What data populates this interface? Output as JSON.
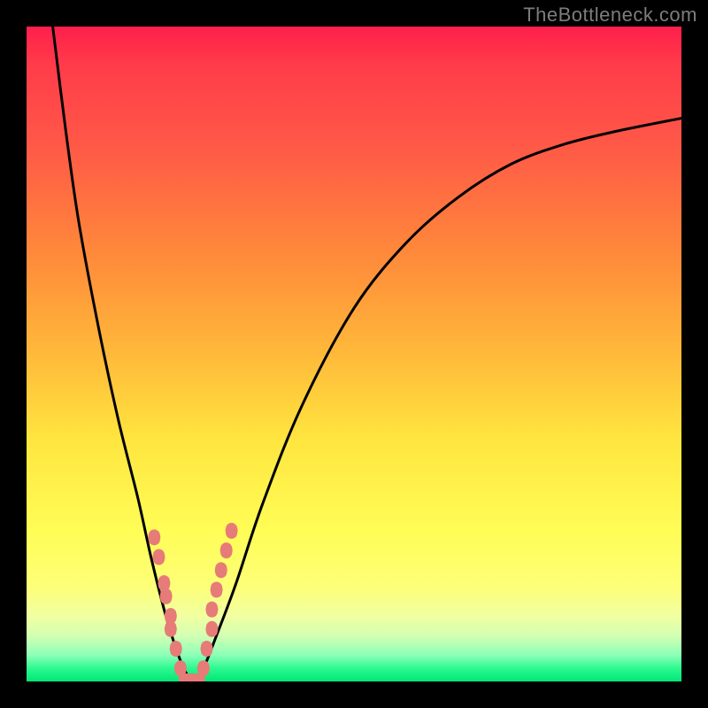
{
  "watermark": "TheBottleneck.com",
  "colors": {
    "frame": "#000000",
    "curve": "#000000",
    "marker": "#e77b78",
    "gradient_stops": [
      {
        "pos": 0.0,
        "hex": "#ff1f4b"
      },
      {
        "pos": 0.06,
        "hex": "#ff3c4a"
      },
      {
        "pos": 0.18,
        "hex": "#ff5847"
      },
      {
        "pos": 0.35,
        "hex": "#ff8a3a"
      },
      {
        "pos": 0.5,
        "hex": "#ffb93a"
      },
      {
        "pos": 0.63,
        "hex": "#ffe53f"
      },
      {
        "pos": 0.77,
        "hex": "#fffd56"
      },
      {
        "pos": 0.855,
        "hex": "#fdff78"
      },
      {
        "pos": 0.9,
        "hex": "#f1ffa0"
      },
      {
        "pos": 0.93,
        "hex": "#d3ffb2"
      },
      {
        "pos": 0.96,
        "hex": "#8cffb8"
      },
      {
        "pos": 0.98,
        "hex": "#2cf98f"
      },
      {
        "pos": 1.0,
        "hex": "#00e776"
      }
    ]
  },
  "chart_data": {
    "type": "line",
    "title": "",
    "xlabel": "",
    "ylabel": "",
    "xlim": [
      0,
      100
    ],
    "ylim": [
      0,
      100
    ],
    "note": "Axes are not labeled in the source image; x and y are normalized 0–100 left-to-right and bottom-to-top.",
    "series": [
      {
        "name": "bottleneck-curve",
        "x": [
          4,
          6,
          8,
          11,
          14,
          17,
          19,
          21,
          22.5,
          24,
          25.5,
          27,
          29,
          32,
          36,
          42,
          50,
          58,
          66,
          74,
          82,
          90,
          100
        ],
        "y": [
          100,
          84,
          70,
          54,
          40,
          28,
          19,
          11,
          6,
          2,
          0,
          2,
          7,
          15,
          27,
          42,
          57,
          67,
          74,
          79,
          82,
          84,
          86
        ]
      }
    ],
    "markers": [
      {
        "name": "left-cluster",
        "x": [
          19.5,
          20.2,
          21.0,
          21.3,
          22.0,
          22.0,
          22.8,
          23.5
        ],
        "y": [
          22,
          19,
          15,
          13,
          10,
          8,
          5,
          2
        ]
      },
      {
        "name": "right-cluster",
        "x": [
          27.0,
          27.5,
          28.3,
          28.3,
          29.0,
          29.7,
          30.5,
          31.3
        ],
        "y": [
          2,
          5,
          8,
          11,
          14,
          17,
          20,
          23
        ]
      },
      {
        "name": "bottom-flat",
        "x": [
          24.3,
          25.2,
          26.2
        ],
        "y": [
          0,
          0,
          0
        ]
      }
    ],
    "minimum": {
      "x": 25.5,
      "y": 0
    }
  }
}
